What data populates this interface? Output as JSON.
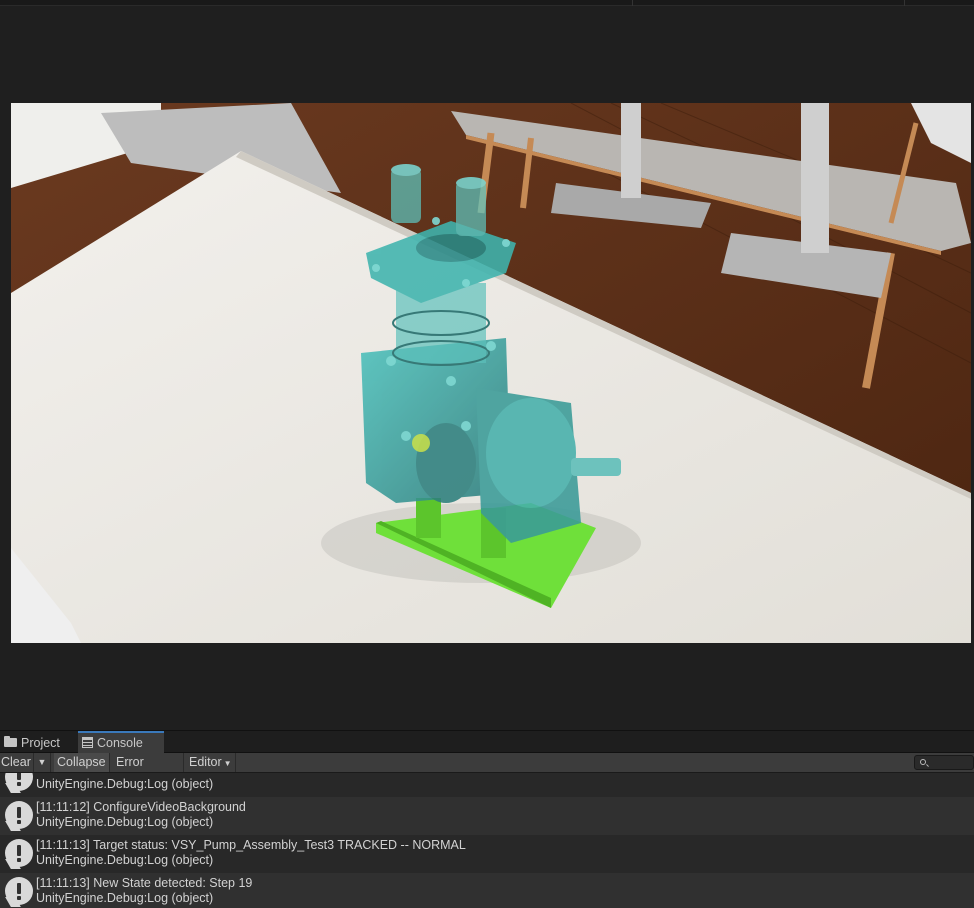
{
  "tabs": [
    {
      "label": "Project",
      "icon": "folder-icon"
    },
    {
      "label": "Console",
      "icon": "console-icon"
    }
  ],
  "toolbar": {
    "clear_label": "Clear",
    "collapse_label": "Collapse",
    "error_pause_label": "Error Pause",
    "editor_label": "Editor"
  },
  "logs": [
    {
      "message": "",
      "source": "UnityEngine.Debug:Log (object)"
    },
    {
      "message": "[11:11:12] ConfigureVideoBackground",
      "source": "UnityEngine.Debug:Log (object)"
    },
    {
      "message": "[11:11:13] Target status: VSY_Pump_Assembly_Test3 TRACKED -- NORMAL",
      "source": "UnityEngine.Debug:Log (object)"
    },
    {
      "message": "[11:11:13] New State detected: Step 19",
      "source": "UnityEngine.Debug:Log (object)"
    }
  ],
  "colors": {
    "accent": "#3a79bb",
    "model_teal": "#3fa9a6",
    "base_green": "#6fe03a"
  }
}
